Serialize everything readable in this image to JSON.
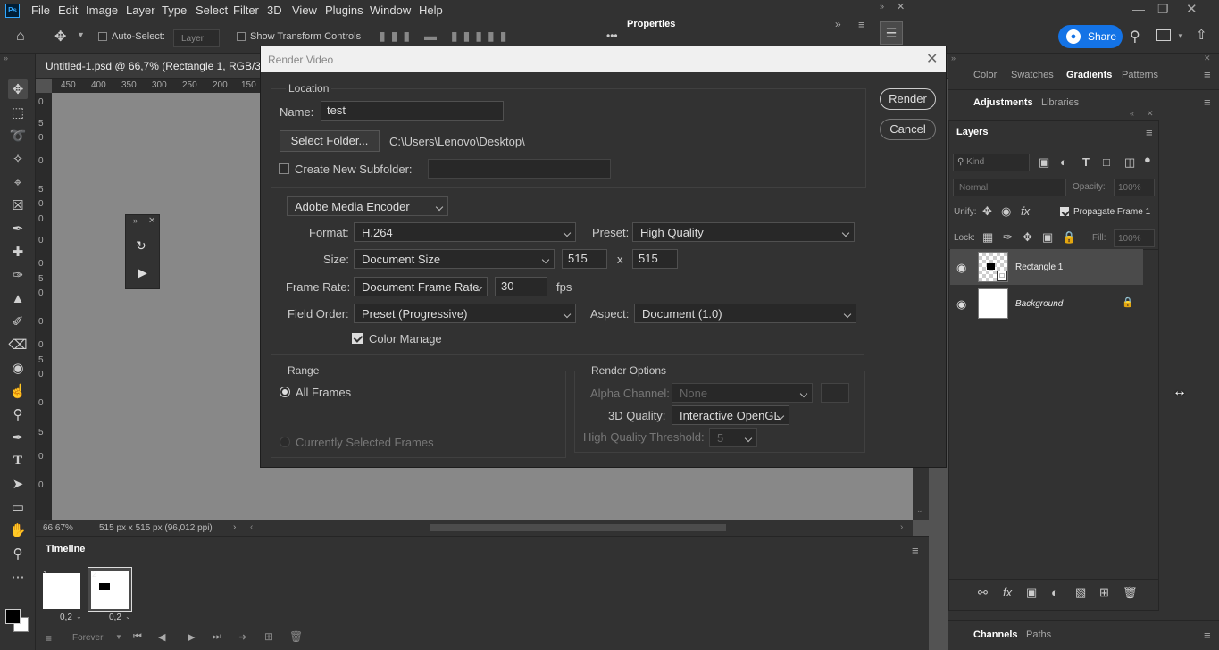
{
  "app": {
    "logo": "Ps"
  },
  "menu": [
    "File",
    "Edit",
    "Image",
    "Layer",
    "Type",
    "Select",
    "Filter",
    "3D",
    "View",
    "Plugins",
    "Window",
    "Help"
  ],
  "options_bar": {
    "auto_select_label": "Auto-Select:",
    "auto_select_value": "Layer",
    "show_transform_label": "Show Transform Controls",
    "share_label": "Share",
    "more": "•••"
  },
  "document": {
    "tab_title": "Untitled-1.psd @ 66,7% (Rectangle 1, RGB/32*",
    "ruler_h": [
      "450",
      "400",
      "350",
      "300",
      "250",
      "200",
      "150"
    ],
    "ruler_v": [
      "0",
      "5",
      "0",
      "0",
      "5",
      "0",
      "0",
      "0",
      "0",
      "5",
      "0",
      "0",
      "0",
      "5",
      "0",
      "0",
      "5",
      "0",
      "0"
    ],
    "zoom": "66,67%",
    "doc_info": "515 px x 515 px (96,012 ppi)"
  },
  "properties_panel": {
    "title": "Properties"
  },
  "timeline": {
    "title": "Timeline",
    "frames": [
      {
        "num": "1",
        "delay": "0,2"
      },
      {
        "num": "2",
        "delay": "0,2"
      }
    ],
    "loop": "Forever"
  },
  "right_panel": {
    "tabs_top": [
      "Color",
      "Swatches",
      "Gradients",
      "Patterns"
    ],
    "active_top": "Gradients",
    "tabs_second": [
      "Adjustments",
      "Libraries"
    ],
    "layers_title": "Layers",
    "kind_label": "Kind",
    "blend_mode": "Normal",
    "opacity_label": "Opacity:",
    "opacity_value": "100%",
    "unify_label": "Unify:",
    "propagate_label": "Propagate Frame 1",
    "lock_label": "Lock:",
    "fill_label": "Fill:",
    "fill_value": "100%",
    "layers": [
      {
        "name": "Rectangle 1"
      },
      {
        "name": "Background"
      }
    ],
    "tabs_bottom": [
      "Channels",
      "Paths"
    ]
  },
  "dialog": {
    "title": "Render Video",
    "location": {
      "legend": "Location",
      "name_label": "Name:",
      "name_value": "test",
      "select_folder": "Select Folder...",
      "folder_path": "C:\\Users\\Lenovo\\Desktop\\",
      "subfolder_label": "Create New Subfolder:",
      "subfolder_value": ""
    },
    "encoder": "Adobe Media Encoder",
    "format_label": "Format:",
    "format_value": "H.264",
    "preset_label": "Preset:",
    "preset_value": "High Quality",
    "size_label": "Size:",
    "size_value": "Document Size",
    "width": "515",
    "x_sep": "x",
    "height": "515",
    "frame_rate_label": "Frame Rate:",
    "frame_rate_value": "Document Frame Rate",
    "fps_value": "30",
    "fps_unit": "fps",
    "field_order_label": "Field Order:",
    "field_order_value": "Preset (Progressive)",
    "aspect_label": "Aspect:",
    "aspect_value": "Document (1.0)",
    "color_manage_label": "Color Manage",
    "range": {
      "legend": "Range",
      "all_frames": "All Frames",
      "selected_frames": "Currently Selected Frames"
    },
    "render_options": {
      "legend": "Render Options",
      "alpha_label": "Alpha Channel:",
      "alpha_value": "None",
      "quality_label": "3D Quality:",
      "quality_value": "Interactive OpenGL",
      "threshold_label": "High Quality Threshold:",
      "threshold_value": "5"
    },
    "render_button": "Render",
    "cancel_button": "Cancel"
  }
}
